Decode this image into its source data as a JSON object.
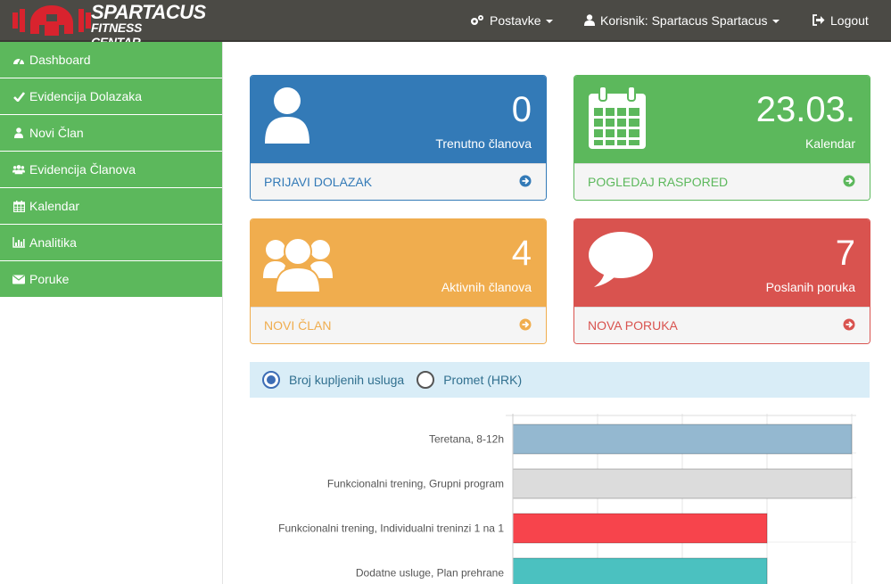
{
  "brand": {
    "line1": "SPARTACUS",
    "line2": "FITNESS CENTAR",
    "accent": "#d9232e"
  },
  "navbar": {
    "settings_label": "Postavke",
    "user_label": "Korisnik: Spartacus Spartacus",
    "logout_label": "Logout",
    "settings_icon": "cogs-icon",
    "user_icon": "user-icon",
    "logout_icon": "sign-out-icon"
  },
  "sidebar": {
    "items": [
      {
        "label": "Dashboard",
        "icon": "dashboard-icon"
      },
      {
        "label": "Evidencija Dolazaka",
        "icon": "check-icon"
      },
      {
        "label": "Novi Član",
        "icon": "user-icon"
      },
      {
        "label": "Evidencija Članova",
        "icon": "users-icon"
      },
      {
        "label": "Kalendar",
        "icon": "calendar-icon"
      },
      {
        "label": "Analitika",
        "icon": "bar-chart-icon"
      },
      {
        "label": "Poruke",
        "icon": "envelope-icon"
      }
    ]
  },
  "cards": [
    {
      "value": "0",
      "label": "Trenutno članova",
      "action": "PRIJAVI DOLAZAK",
      "color": "#337ab7",
      "icon": "user-icon"
    },
    {
      "value": "23.03.",
      "label": "Kalendar",
      "action": "POGLEDAJ RASPORED",
      "color": "#5cb85c",
      "icon": "calendar-icon"
    },
    {
      "value": "4",
      "label": "Aktivnih članova",
      "action": "NOVI ČLAN",
      "color": "#f0ad4e",
      "icon": "users-icon"
    },
    {
      "value": "7",
      "label": "Poslanih poruka",
      "action": "NOVA PORUKA",
      "color": "#d9534f",
      "icon": "comment-icon"
    }
  ],
  "chart_toggle": {
    "options": [
      "Broj kupljenih usluga",
      "Promet (HRK)"
    ],
    "selected": "Broj kupljenih usluga"
  },
  "chart_data": {
    "type": "bar",
    "orientation": "horizontal",
    "categories": [
      "Teretana, 8-12h",
      "Funkcionalni trening, Grupni program",
      "Funkcionalni trening, Individualni treninzi 1 na 1",
      "Dodatne usluge, Plan prehrane"
    ],
    "values": [
      4,
      4,
      3,
      3
    ],
    "colors": [
      "#94b8d0",
      "#dcdcdc",
      "#f7444c",
      "#4bc1c0"
    ],
    "xlim": [
      0,
      4
    ],
    "grid": true
  }
}
